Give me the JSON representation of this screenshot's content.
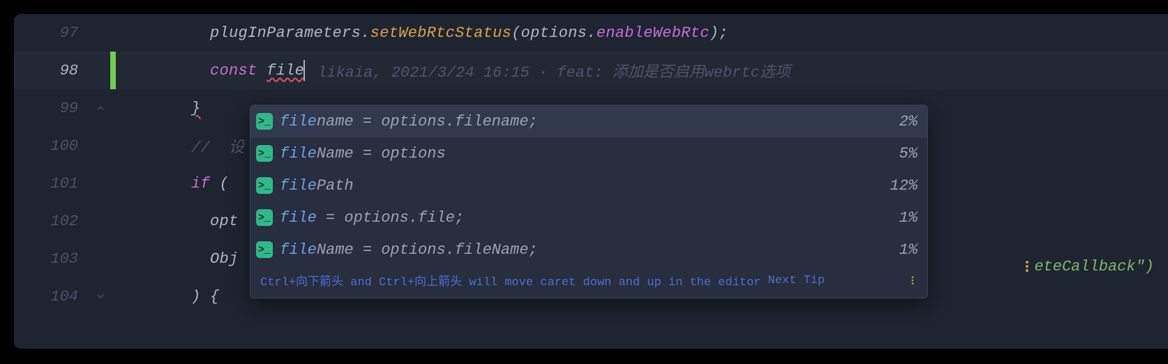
{
  "gutter": {
    "lines": [
      "97",
      "98",
      "99",
      "100",
      "101",
      "102",
      "103",
      "104"
    ]
  },
  "code": {
    "l97_obj": "plugInParameters",
    "l97_dot": ".",
    "l97_method": "setWebRtcStatus",
    "l97_lp": "(",
    "l97_arg1": "options",
    "l97_dot2": ".",
    "l97_arg2": "enableWebRtc",
    "l97_rp": ");",
    "l98_const": "const",
    "l98_space": " ",
    "l98_var": "file",
    "l99_brace": "}",
    "l100_comment": "//  设",
    "l101_if": "if",
    "l101_lp": " (",
    "l102_opt": "opt",
    "l103_obj": "Obj",
    "l104_close": ") {",
    "behind_text": "eteCallback\")",
    "behind_string": "eteCallback",
    "behind_tail": "\")"
  },
  "blame": {
    "author": "likaia",
    "date": "2021/3/24 16:15",
    "sep": " · ",
    "msg_prefix": "feat: ",
    "msg": "添加是否启用webrtc选项"
  },
  "popup": {
    "items": [
      {
        "match": "file",
        "rest": "name = options.filename;",
        "pct": "2%"
      },
      {
        "match": "file",
        "rest": "Name = options",
        "pct": "5%"
      },
      {
        "match": "file",
        "rest": "Path",
        "pct": "12%"
      },
      {
        "match": "file",
        "rest": " = options.file;",
        "pct": "1%"
      },
      {
        "match": "file",
        "rest": "Name = options.fileName;",
        "pct": "1%"
      }
    ],
    "tip_text": "Ctrl+向下箭头 and Ctrl+向上箭头 will move caret down and up in the editor",
    "tip_next": "Next Tip"
  },
  "icons": {
    "terminal": ">_"
  }
}
